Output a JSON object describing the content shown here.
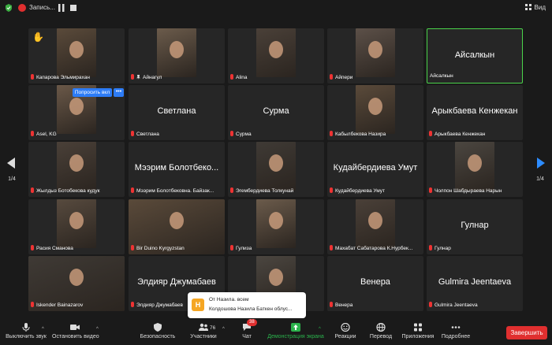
{
  "topbar": {
    "recording_label": "Запись...",
    "view_label": "Вид"
  },
  "colors": {
    "active_border": "#4bd44b",
    "accent_blue": "#2d7cf6",
    "danger_red": "#e02f2f",
    "notification_avatar": "#f5a623"
  },
  "tiles": [
    {
      "name": "Капарова Эльмирахан",
      "mic_off": true,
      "has_video": true,
      "raised_hand": true
    },
    {
      "name": "Айнагул",
      "mic_off": true,
      "pinned": true,
      "has_video": true
    },
    {
      "name": "Alina",
      "mic_off": true,
      "has_video": true
    },
    {
      "name": "Айпери",
      "mic_off": true,
      "has_video": true
    },
    {
      "name": "Айсалкын",
      "big_name": "Айсалкын",
      "active_speaker": true
    },
    {
      "name": "Asel, KG",
      "mic_off": true,
      "has_video": true
    },
    {
      "name": "Светлана",
      "big_name": "Светлана",
      "mic_off": true
    },
    {
      "name": "Сурма",
      "big_name": "Сурма",
      "mic_off": true
    },
    {
      "name": "Кабылбекова Назира",
      "mic_off": true,
      "has_video": true
    },
    {
      "name": "Арыкбаева Кенжекан",
      "big_name": "Арыкбаева Кенжекан",
      "mic_off": true
    },
    {
      "name": "Жылдыз Ботобекова кудук",
      "mic_off": true,
      "has_video": true
    },
    {
      "name": "Мээрим Болотбековна. Байзак...",
      "big_name": "Мээрим Болотбеко...",
      "mic_off": true
    },
    {
      "name": "Эгембердиева Толкунай",
      "mic_off": true,
      "has_video": true
    },
    {
      "name": "Кудайбердиева Умут",
      "big_name": "Кудайбердиева Умут",
      "mic_off": true
    },
    {
      "name": "Чолпон Шабдыраева Нарын",
      "mic_off": true,
      "has_video": true
    },
    {
      "name": "Расия Сманова",
      "mic_off": true,
      "has_video": true
    },
    {
      "name": "Bir Duino Kyrgyzstan",
      "mic_off": true,
      "has_video": true
    },
    {
      "name": "Гулиза",
      "mic_off": true,
      "has_video": true
    },
    {
      "name": "Махабат Сабатарова К.Нурбек...",
      "mic_off": true,
      "has_video": true
    },
    {
      "name": "Гулнар",
      "big_name": "Гулнар",
      "mic_off": true
    },
    {
      "name": "Iskender Bainazarov",
      "mic_off": true,
      "has_video": true
    },
    {
      "name": "Элдияр Джумабаев",
      "big_name": "Элдияр Джумабаев",
      "mic_off": true
    },
    {
      "name": "",
      "has_video": true
    },
    {
      "name": "Венера",
      "big_name": "Венера",
      "mic_off": true
    },
    {
      "name": "Gulmira Jeentaeva",
      "big_name": "Gulmira Jeentaeva",
      "mic_off": true
    }
  ],
  "overlay": {
    "ask_button": "Попросить вкл",
    "more_button": "•••"
  },
  "pagination": {
    "left": "1/4",
    "right": "1/4"
  },
  "notification": {
    "avatar_letter": "Н",
    "from": "От Назила. всем",
    "message": "Колдошова Назила Баткен облус..."
  },
  "toolbar": {
    "mute": "Выключить звук",
    "video": "Остановить видео",
    "security": "Безопасность",
    "participants": "Участники",
    "participants_count": "76",
    "chat": "Чат",
    "chat_badge": "38",
    "share": "Демонстрация экрана",
    "reactions": "Реакции",
    "translate": "Перевод",
    "apps": "Приложения",
    "more": "Подробнее",
    "end": "Завершить"
  }
}
